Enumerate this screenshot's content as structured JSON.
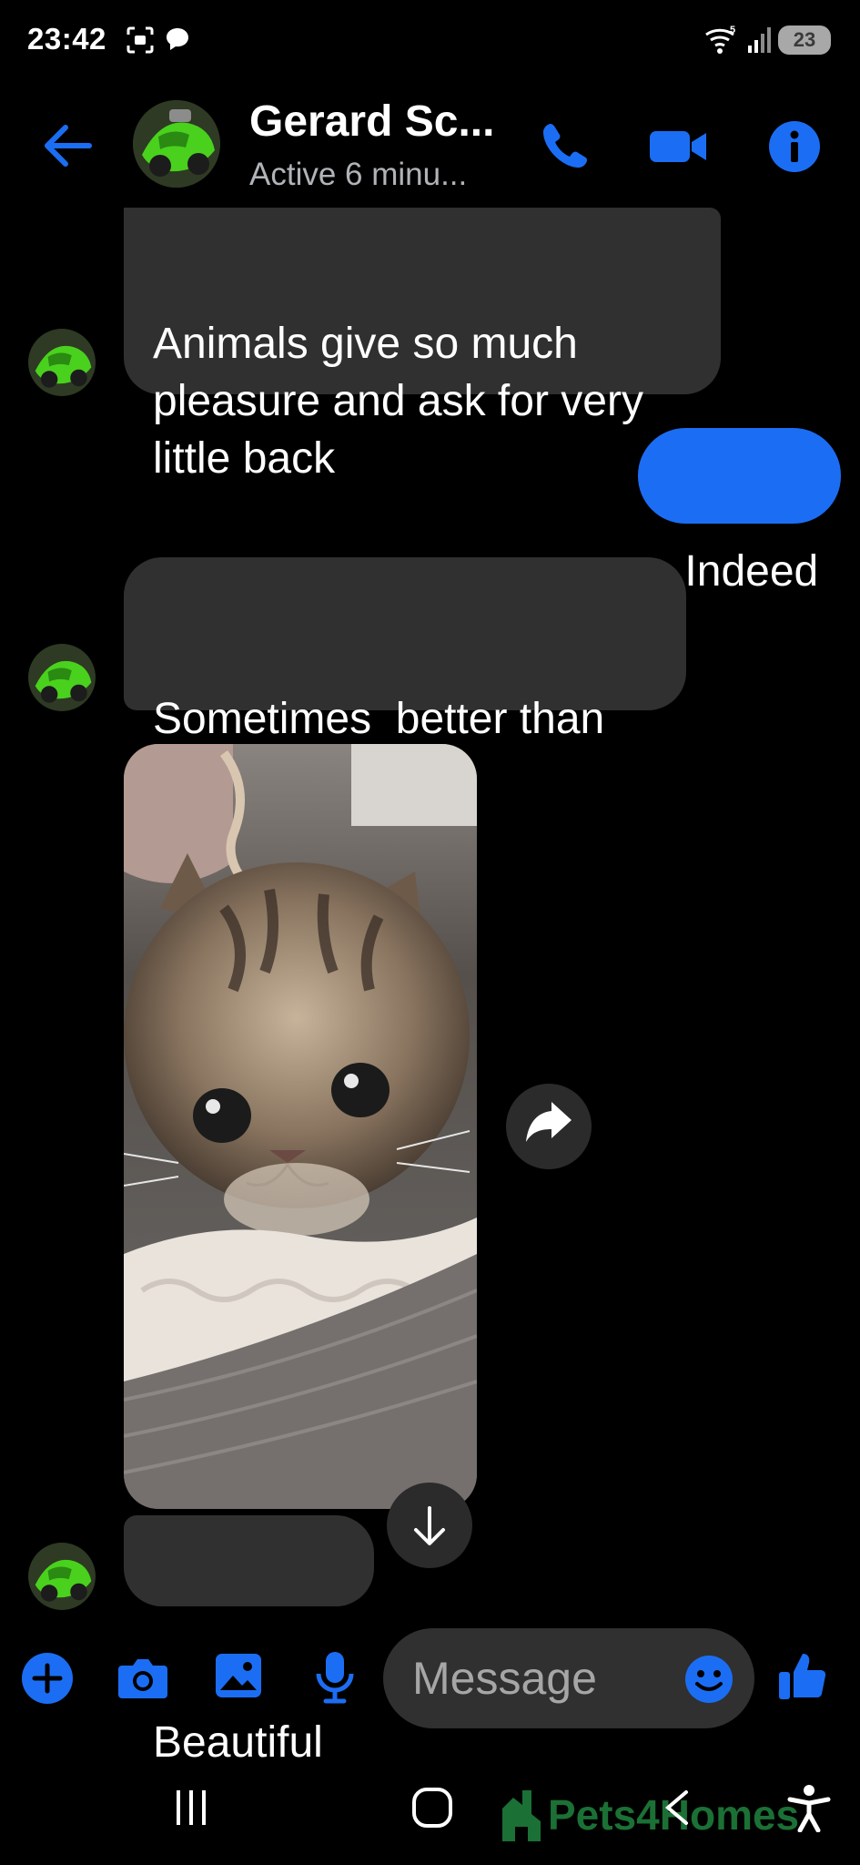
{
  "status_bar": {
    "time": "23:42",
    "wifi_badge": "5",
    "battery": "23",
    "icons": [
      "screenshot-icon",
      "chat-notification-icon",
      "wifi-icon",
      "signal-icon",
      "battery-icon"
    ]
  },
  "header": {
    "contact_name": "Gerard Sc...",
    "status": "Active 6 minu...",
    "icons": [
      "back-arrow-icon",
      "phone-icon",
      "video-camera-icon",
      "info-icon"
    ]
  },
  "messages": [
    {
      "direction": "incoming",
      "text": "Animals give so much\npleasure and ask for very\nlittle back"
    },
    {
      "direction": "outgoing",
      "text": "Indeed"
    },
    {
      "direction": "incoming",
      "text": "Sometimes  better than\npeople"
    },
    {
      "direction": "incoming",
      "type": "image",
      "subject": "kitten"
    },
    {
      "direction": "incoming",
      "text": "Beautiful"
    }
  ],
  "composer": {
    "placeholder": "Message",
    "icons": [
      "plus-icon",
      "camera-icon",
      "gallery-icon",
      "microphone-icon",
      "emoji-icon",
      "thumbs-up-icon"
    ]
  },
  "navbar": {
    "watermark": "Pets4Homes",
    "icons": [
      "recent-apps-icon",
      "home-icon",
      "back-icon",
      "accessibility-icon"
    ]
  },
  "colors": {
    "background": "#000000",
    "accent": "#1b6ef3",
    "incoming_bubble": "#303030",
    "secondary_text": "#b0b3b8"
  }
}
